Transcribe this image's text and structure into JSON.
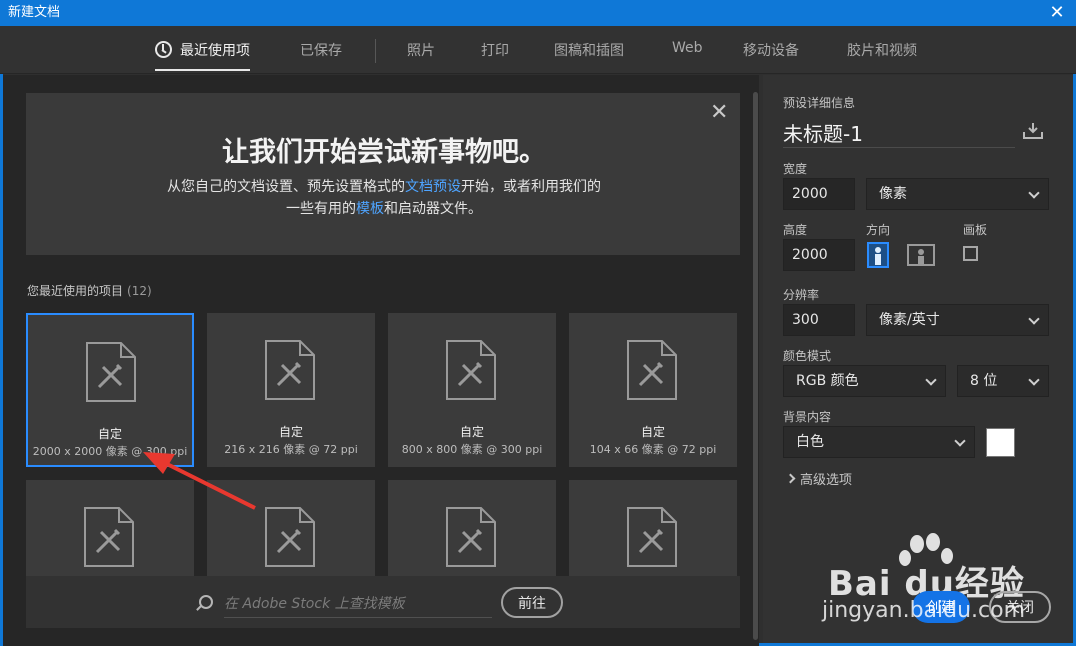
{
  "window": {
    "title": "新建文档",
    "close_glyph": "✕"
  },
  "tabs": [
    {
      "label": "最近使用项",
      "active": true
    },
    {
      "label": "已保存"
    },
    {
      "label": "照片"
    },
    {
      "label": "打印"
    },
    {
      "label": "图稿和插图"
    },
    {
      "label": "Web"
    },
    {
      "label": "移动设备"
    },
    {
      "label": "胶片和视频"
    }
  ],
  "hero": {
    "title": "让我们开始尝试新事物吧。",
    "line1_a": "从您自己的文档设置、预先设置格式的",
    "line1_link": "文档预设",
    "line1_b": "开始，或者利用我们的",
    "line2_a": "一些有用的",
    "line2_link": "模板",
    "line2_b": "和启动器文件。",
    "close_glyph": "✕"
  },
  "recent": {
    "label": "您最近使用的项目",
    "count": "(12)",
    "items": [
      {
        "name": "自定",
        "spec": "2000 x 2000 像素 @ 300 ppi",
        "selected": true
      },
      {
        "name": "自定",
        "spec": "216 x 216 像素 @ 72 ppi"
      },
      {
        "name": "自定",
        "spec": "800 x 800 像素 @ 300 ppi"
      },
      {
        "name": "自定",
        "spec": "104 x 66 像素 @ 72 ppi"
      }
    ]
  },
  "search": {
    "placeholder": "在 Adobe Stock 上查找模板",
    "go_label": "前往"
  },
  "preset": {
    "section_label": "预设详细信息",
    "doc_name": "未标题-1",
    "width_label": "宽度",
    "width_value": "2000",
    "width_unit": "像素",
    "height_label": "高度",
    "height_value": "2000",
    "orientation_label": "方向",
    "artboard_label": "画板",
    "resolution_label": "分辨率",
    "resolution_value": "300",
    "resolution_unit": "像素/英寸",
    "color_mode_label": "颜色模式",
    "color_mode": "RGB 颜色",
    "bit_depth": "8 位",
    "background_label": "背景内容",
    "background": "白色",
    "advanced_label": "高级选项"
  },
  "actions": {
    "create": "创建",
    "close": "关闭"
  },
  "watermark": {
    "brand": "Bai du经验",
    "url": "jingyan.baidu.com"
  },
  "colors": {
    "accent": "#2a8cff",
    "titlebar": "#0f78d7",
    "link": "#4ea4ff",
    "arrow": "#e8382f"
  }
}
